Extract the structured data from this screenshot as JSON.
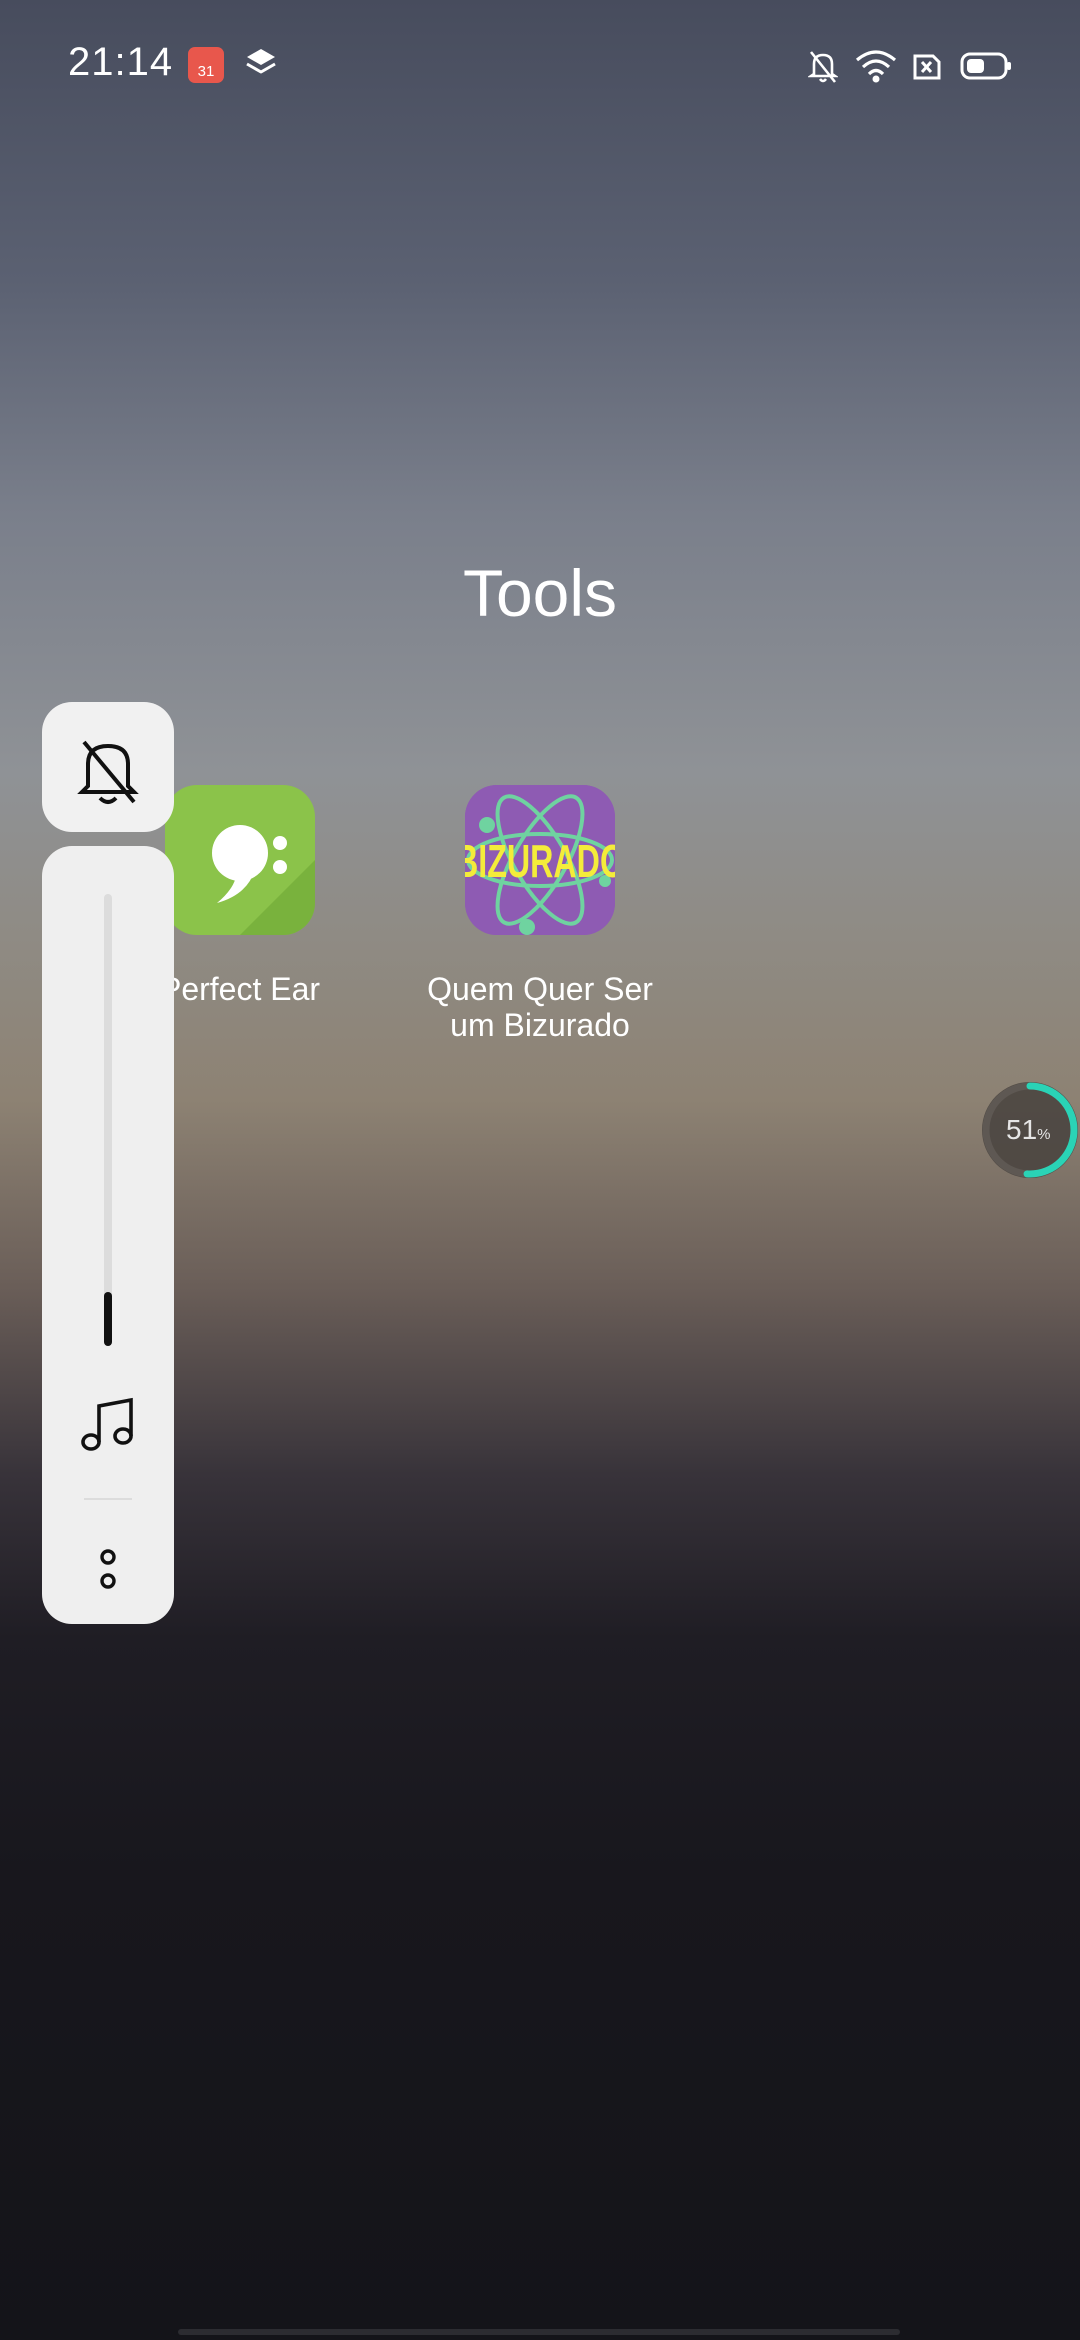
{
  "status_bar": {
    "time": "21:14",
    "calendar_day": "31",
    "icons": [
      "calendar-icon",
      "layers-icon",
      "bell-off-icon",
      "wifi-icon",
      "sim-off-icon",
      "battery-icon"
    ]
  },
  "folder": {
    "title": "Tools",
    "apps": [
      {
        "label": "Perfect Ear",
        "icon": "perfect-ear-icon",
        "icon_color": "#8bc34a"
      },
      {
        "label": "Quem Quer Ser um Bizurado",
        "icon_text": "BIZURADO",
        "icon": "bizurado-icon",
        "icon_color": "#8e5bb3"
      }
    ]
  },
  "volume_panel": {
    "level_fraction": 0.12,
    "icons": [
      "bell-off-icon",
      "music-note-icon",
      "more-options-icon"
    ]
  },
  "usage_widget": {
    "value": "51",
    "unit": "%",
    "fraction": 0.51,
    "accent": "#2ad3b6"
  }
}
